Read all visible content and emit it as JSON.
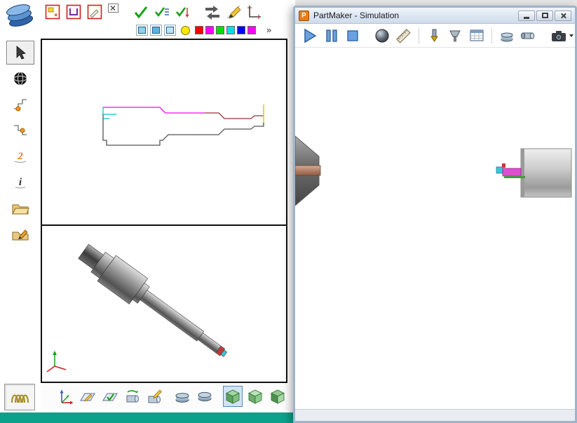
{
  "main_window": {
    "toolbar_row1": {
      "icons": [
        "pattern-doc",
        "pattern-save",
        "pattern-edit",
        "close-doc",
        "verify-check",
        "verify-list",
        "verify-update",
        "swap-arrows",
        "slope-edit",
        "corner-dimension"
      ]
    },
    "toolbar_row2": {
      "fill_style_colors": [
        "#8FD0EA",
        "#5AB2DC",
        "#BFE2F2"
      ],
      "current_color": "#FFE800",
      "palette": [
        "#FF0000",
        "#FF00FF",
        "#00E000",
        "#00E0E0",
        "#0000FF",
        "#FF00FF"
      ],
      "more_label": "»"
    },
    "tool_palette": {
      "icons": [
        "select",
        "rotate-view",
        "contour-pick",
        "contour-pick-alt",
        "two-axis",
        "info",
        "open-folder",
        "edit-folder",
        "spring-coil"
      ],
      "selected": "select",
      "two_axis_glyph": "2",
      "info_glyph": "i"
    },
    "view_toolbar": {
      "icons": [
        "axes",
        "sketch-plane",
        "verify-plane",
        "cylinder-rotate",
        "cylinder-edit",
        "stock-disks",
        "stock-disk",
        "iso-view-shaded",
        "iso-view-alt",
        "iso-view-alt2"
      ],
      "selected": "iso-view-shaded"
    },
    "statusbar_color": "#0BA18A"
  },
  "sim_window": {
    "title": "PartMaker - Simulation",
    "app_icon_letter": "P",
    "window_buttons": [
      "minimize",
      "maximize",
      "close"
    ],
    "toolbar": {
      "icons": [
        "play",
        "pause",
        "stop",
        "view-sphere",
        "measure-ruler",
        "tool-insert",
        "tool-holder",
        "process-grid",
        "stock-disks",
        "chuck",
        "snapshot-camera"
      ]
    }
  }
}
